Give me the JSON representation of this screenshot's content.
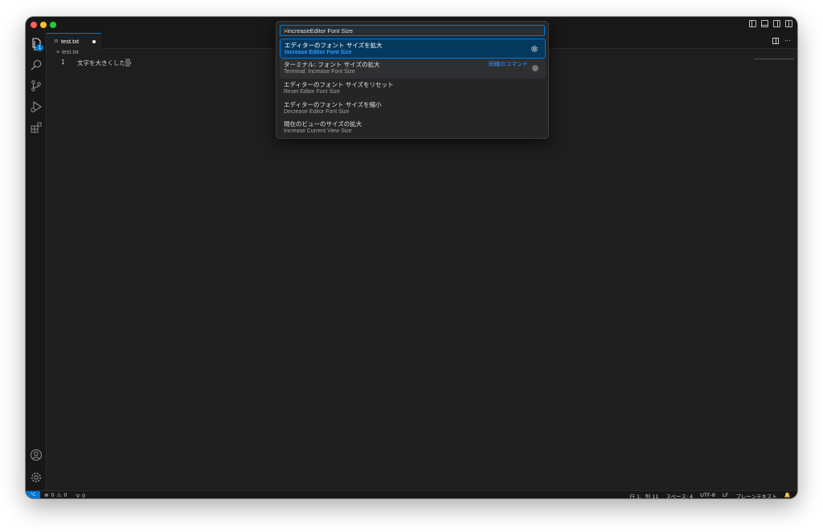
{
  "window": {
    "accent": "#0078d4",
    "background": "#1e1e1e"
  },
  "activity_bar": {
    "items": [
      {
        "name": "explorer-icon",
        "badge": "1"
      },
      {
        "name": "search-icon"
      },
      {
        "name": "source-control-icon"
      },
      {
        "name": "run-debug-icon"
      },
      {
        "name": "extensions-icon"
      },
      {
        "name": "account-icon"
      },
      {
        "name": "settings-gear-icon"
      }
    ]
  },
  "tab": {
    "icon": "≡",
    "label": "test.txt",
    "modified": true
  },
  "breadcrumb": {
    "icon": "≡",
    "file": "test.txt"
  },
  "editor": {
    "line_number": "1",
    "line_text": "文字を大きくしたい"
  },
  "command_palette": {
    "input_value": ">increaseEditor Font Size",
    "items": [
      {
        "title": "エディターのフォント サイズを拡大",
        "subtitle": "Increase Editor Font Size",
        "selected": true,
        "gear": true
      },
      {
        "title": "ターミナル: フォント サイズの拡大",
        "subtitle": "Terminal: Increase Font Size",
        "similar": "同様のコマンド",
        "gear": true
      },
      {
        "title": "エディターのフォント サイズをリセット",
        "subtitle": "Reset Editor Font Size"
      },
      {
        "title": "エディターのフォント サイズを縮小",
        "subtitle": "Decrease Editor Font Size"
      },
      {
        "title": "現在のビューのサイズの拡大",
        "subtitle": "Increase Current View Size"
      }
    ]
  },
  "status_bar": {
    "remote": "⌥",
    "errors": "0",
    "warnings": "0",
    "ports": "0",
    "position": "行 1、列 11",
    "spaces": "スペース: 4",
    "encoding": "UTF-8",
    "eol": "LF",
    "language": "プレーンテキスト",
    "bell": "🔔"
  }
}
